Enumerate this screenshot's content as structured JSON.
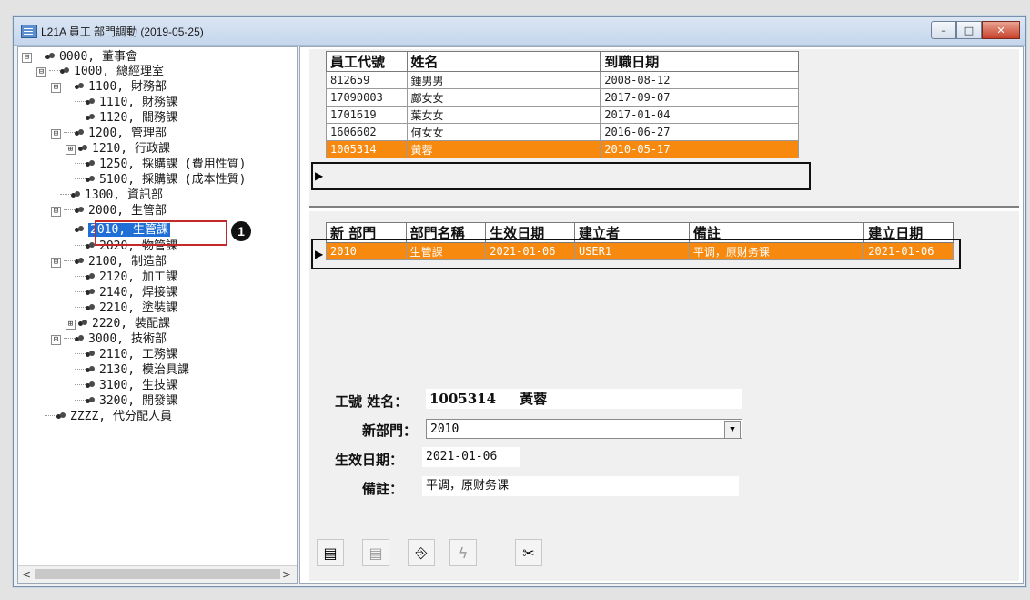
{
  "window": {
    "title": "L21A 員工 部門調動 (2019-05-25)",
    "buttons": {
      "minimize": "–",
      "maximize": "□",
      "close": "✕"
    }
  },
  "tree": {
    "nodes": [
      {
        "label": "0000, 董事會",
        "expander": "⊟"
      },
      {
        "label": "1000, 總經理室",
        "expander": "⊟"
      },
      {
        "label": "1100, 財務部",
        "expander": "⊟"
      },
      {
        "label": "1110, 財務課",
        "expander": ""
      },
      {
        "label": "1120, 關務課",
        "expander": ""
      },
      {
        "label": "1200, 管理部",
        "expander": "⊟"
      },
      {
        "label": "1210, 行政課",
        "expander": "⊞"
      },
      {
        "label": "1250, 採購課 (費用性質)",
        "expander": ""
      },
      {
        "label": "5100, 採購課 (成本性質)",
        "expander": ""
      },
      {
        "label": "1300, 資訊部",
        "expander": ""
      },
      {
        "label": "2000, 生管部",
        "expander": "⊟"
      },
      {
        "label": "2010, 生管課",
        "expander": ""
      },
      {
        "label": "2020, 物管課",
        "expander": ""
      },
      {
        "label": "2100, 制造部",
        "expander": "⊟"
      },
      {
        "label": "2120, 加工課",
        "expander": ""
      },
      {
        "label": "2140, 焊接課",
        "expander": ""
      },
      {
        "label": "2210, 塗裝課",
        "expander": ""
      },
      {
        "label": "2220, 裝配課",
        "expander": "⊞"
      },
      {
        "label": "3000, 技術部",
        "expander": "⊟"
      },
      {
        "label": "2110, 工務課",
        "expander": ""
      },
      {
        "label": "2130, 模治具課",
        "expander": ""
      },
      {
        "label": "3100, 生技課",
        "expander": ""
      },
      {
        "label": "3200, 開發課",
        "expander": ""
      },
      {
        "label": "ZZZZ, 代分配人員",
        "expander": ""
      }
    ],
    "callout": "1",
    "scroll_left": "<",
    "scroll_right": ">"
  },
  "employees": {
    "headers": [
      "員工代號",
      "姓名",
      "到職日期"
    ],
    "rows": [
      [
        "812659",
        "鍾男男",
        "2008-08-12"
      ],
      [
        "17090003",
        "鄺女女",
        "2017-09-07"
      ],
      [
        "1701619",
        "葉女女",
        "2017-01-04"
      ],
      [
        "1606602",
        "何女女",
        "2016-06-27"
      ],
      [
        "1005314",
        "黃蓉",
        "2010-05-17"
      ]
    ]
  },
  "transfers": {
    "headers": [
      "新 部門",
      "部門名稱",
      "生效日期",
      "建立者",
      "備註",
      "建立日期"
    ],
    "rows": [
      [
        "2010",
        "生管課",
        "2021-01-06",
        "USER1",
        "平调，原财务课",
        "2021-01-06"
      ]
    ]
  },
  "form": {
    "id_name_label": "工號 姓名：",
    "emp_id": "1005314",
    "emp_name": "黃蓉",
    "new_dept_label": "新部門：",
    "new_dept_value": "2010",
    "effective_label": "生效日期：",
    "effective_value": "2021-01-06",
    "remark_label": "備註：",
    "remark_value": "平调，原财务课"
  },
  "toolbar": [
    "add-record-icon",
    "delete-record-icon",
    "exit-icon",
    "process-icon",
    "cut-icon"
  ],
  "colors": {
    "highlight_row": "#f7890f",
    "tree_selection": "#1f6fd6",
    "callout_border": "#c22a2a"
  }
}
